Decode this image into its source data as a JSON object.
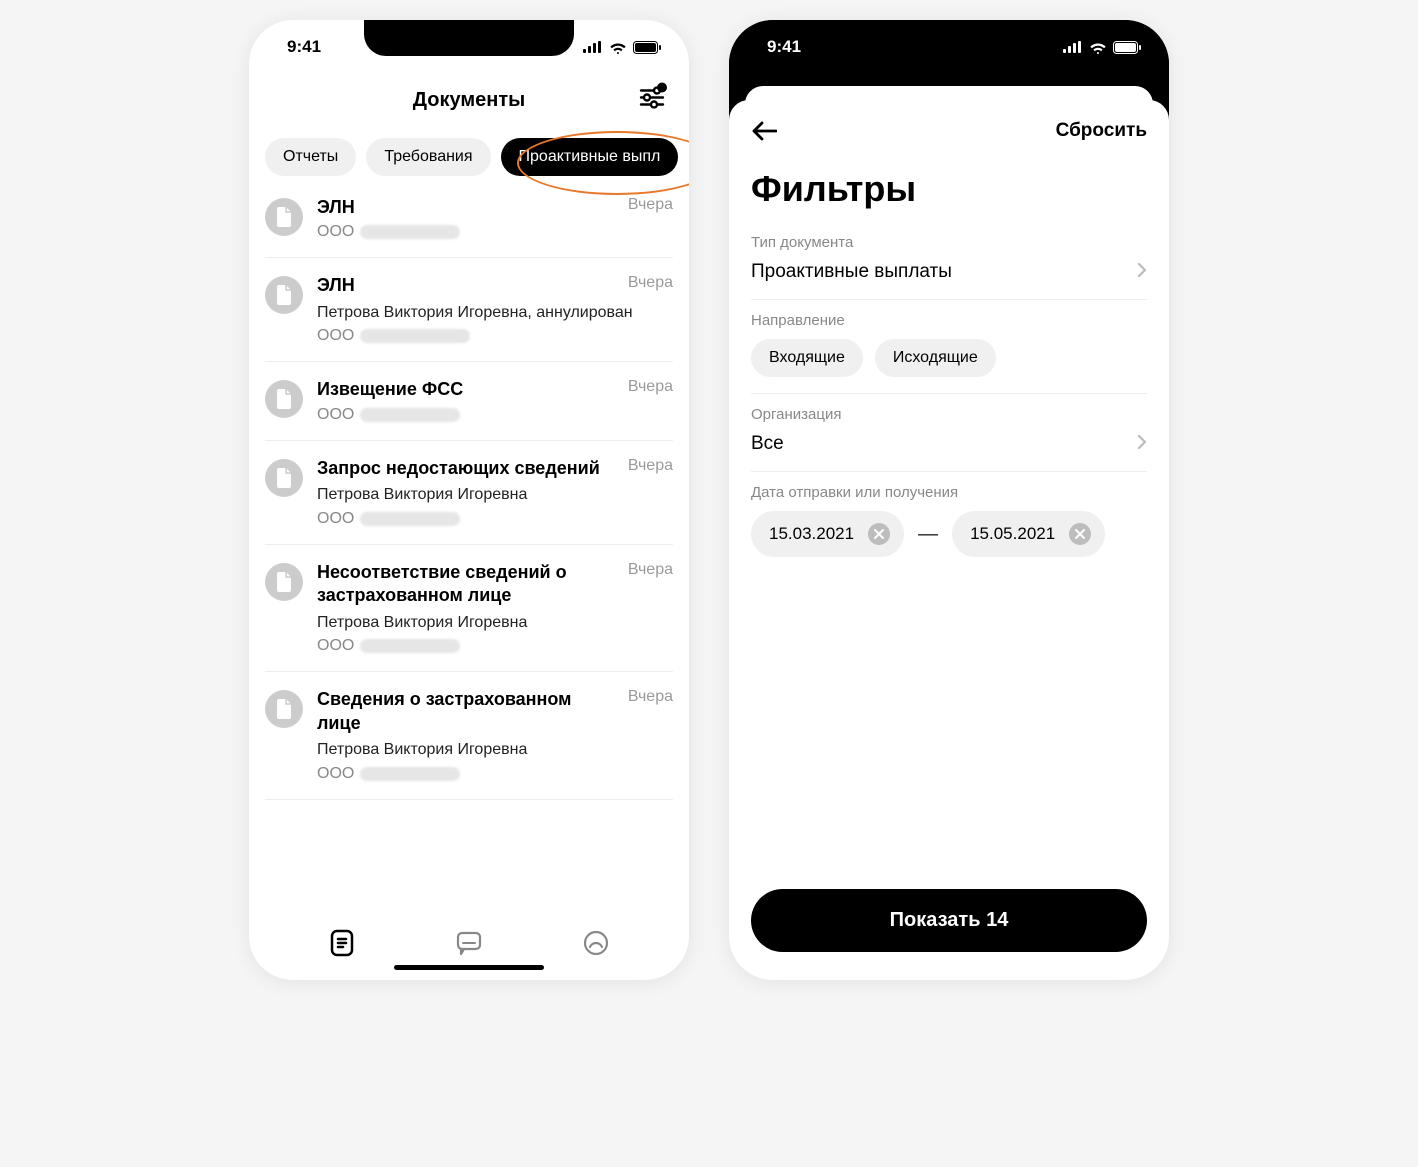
{
  "status": {
    "time": "9:41"
  },
  "screenA": {
    "title": "Документы",
    "chips": {
      "reports": "Отчеты",
      "requirements": "Требования",
      "proactive": "Проактивные выпл"
    },
    "date_label": "Вчера",
    "org_prefix": "ООО",
    "items": [
      {
        "title": "ЭЛН",
        "sub": "",
        "person": ""
      },
      {
        "title": "ЭЛН",
        "sub": "Петрова Виктория Игоревна, аннулирован",
        "person": ""
      },
      {
        "title": "Извещение ФСС",
        "sub": "",
        "person": ""
      },
      {
        "title": "Запрос недостающих сведений",
        "sub": "",
        "person": "Петрова Виктория Игоревна"
      },
      {
        "title": "Несоответствие сведений о застрахованном лице",
        "sub": "",
        "person": "Петрова Виктория Игоревна"
      },
      {
        "title": "Сведения о застрахованном лице",
        "sub": "",
        "person": "Петрова Виктория Игоревна"
      }
    ]
  },
  "screenB": {
    "reset": "Сбросить",
    "title": "Фильтры",
    "doc_type_label": "Тип документа",
    "doc_type_value": "Проактивные выплаты",
    "direction_label": "Направление",
    "direction_in": "Входящие",
    "direction_out": "Исходящие",
    "org_label": "Организация",
    "org_value": "Все",
    "date_label": "Дата отправки или получения",
    "date_from": "15.03.2021",
    "date_to": "15.05.2021",
    "apply": "Показать 14"
  }
}
